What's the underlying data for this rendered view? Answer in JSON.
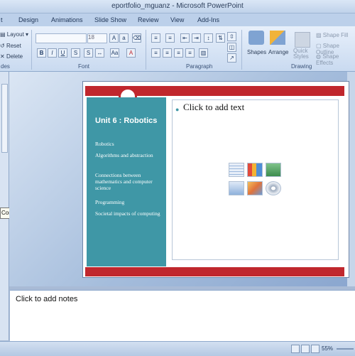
{
  "window": {
    "title": "eportfolio_mguanz - Microsoft PowerPoint"
  },
  "tabs": [
    "t",
    "Design",
    "Animations",
    "Slide Show",
    "Review",
    "View",
    "Add-Ins"
  ],
  "ribbon": {
    "slides_buttons": [
      "Layout",
      "Reset",
      "Delete"
    ],
    "font_name": "",
    "font_size": "18",
    "groups": [
      "des",
      "Font",
      "Paragraph",
      "Drawing"
    ],
    "shapes_label": "Shapes",
    "arrange_label": "Arrange",
    "quick_styles_label": "Quick Styles",
    "shape_fill": "Shape Fill",
    "shape_outline": "Shape Outline",
    "shape_effects": "Shape Effects"
  },
  "tooltip": {
    "text": "Computer liter..."
  },
  "slide": {
    "title": "Unit 6 : Robotics",
    "items": [
      "Robotics",
      "Algorithms and abstraction",
      "Connections between mathematics and computer science",
      "Programming",
      "Societal impacts of computing"
    ],
    "content_placeholder": "Click to add text"
  },
  "notes": {
    "placeholder": "Click to add notes"
  },
  "status": {
    "zoom": "55%"
  },
  "colors": {
    "accent_red": "#c0272d",
    "teal": "#3f97a6"
  }
}
